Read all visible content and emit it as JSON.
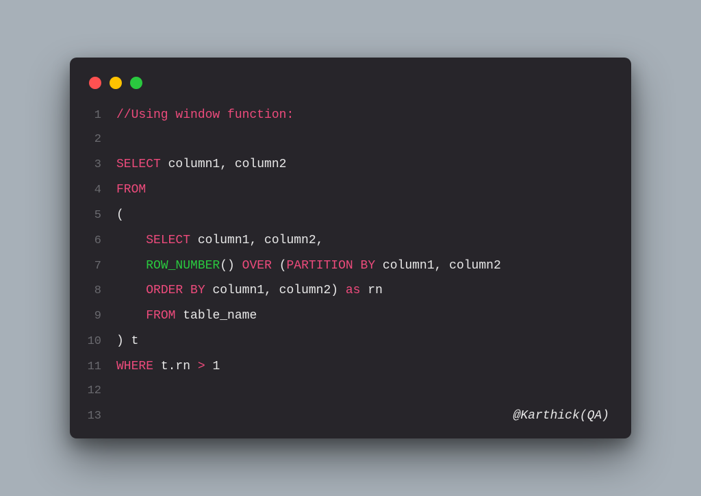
{
  "colors": {
    "background": "#a7b0b8",
    "window": "#27252a",
    "red": "#ff5151",
    "yellow": "#ffc300",
    "green": "#2ac93f",
    "pink": "#ed4b7c",
    "text": "#e8e8e8",
    "gutter": "#6a6a6f"
  },
  "lines": {
    "l1": {
      "num": "1"
    },
    "l2": {
      "num": "2"
    },
    "l3": {
      "num": "3"
    },
    "l4": {
      "num": "4"
    },
    "l5": {
      "num": "5"
    },
    "l6": {
      "num": "6"
    },
    "l7": {
      "num": "7"
    },
    "l8": {
      "num": "8"
    },
    "l9": {
      "num": "9"
    },
    "l10": {
      "num": "10"
    },
    "l11": {
      "num": "11"
    },
    "l12": {
      "num": "12"
    },
    "l13": {
      "num": "13"
    }
  },
  "tok": {
    "comment": "//Using window function:",
    "select": "SELECT",
    "cols12": " column1, column2",
    "cols12c": " column1, column2,",
    "from": "FROM",
    "lparen": "(",
    "indent": "    ",
    "rownum": "ROW_NUMBER",
    "paren_open_close": "()",
    "space": " ",
    "over": "OVER",
    "open_p": " (",
    "partby": "PARTITION BY",
    "orderby": "ORDER BY",
    "cols12_close": " column1, column2) ",
    "as": "as",
    "rn": " rn",
    "table": " table_name",
    "close_t": ") t",
    "where": "WHERE",
    "trn": " t.rn ",
    "gt": ">",
    "one": " 1"
  },
  "attribution": "@Karthick(QA)"
}
